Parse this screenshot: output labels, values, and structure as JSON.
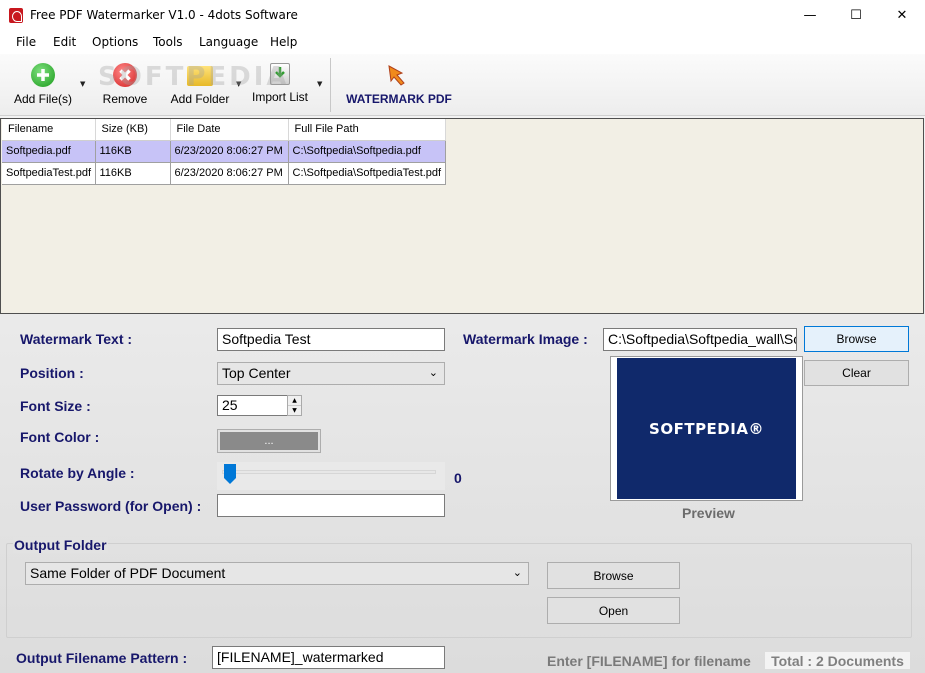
{
  "window": {
    "title": "Free PDF Watermarker V1.0 - 4dots Software",
    "minimize_glyph": "—",
    "maximize_glyph": "☐",
    "close_glyph": "✕"
  },
  "menu": [
    "File",
    "Edit",
    "Options",
    "Tools",
    "Language",
    "Help"
  ],
  "toolbar": {
    "add_files": "Add File(s)",
    "remove": "Remove",
    "add_folder": "Add Folder",
    "import_list": "Import List",
    "watermark_pdf": "WATERMARK PDF",
    "watermark_text_overlay": "SOFTPEDIA",
    "dropdown_glyph": "▼"
  },
  "file_table": {
    "columns": [
      "Filename",
      "Size (KB)",
      "File Date",
      "Full File Path"
    ],
    "rows": [
      [
        "Softpedia.pdf",
        "116KB",
        "6/23/2020 8:06:27 PM",
        "C:\\Softpedia\\Softpedia.pdf"
      ],
      [
        "SoftpediaTest.pdf",
        "116KB",
        "6/23/2020 8:06:27 PM",
        "C:\\Softpedia\\SoftpediaTest.pdf"
      ]
    ]
  },
  "form": {
    "watermark_text_label": "Watermark Text :",
    "watermark_text_value": "Softpedia Test",
    "position_label": "Position :",
    "position_value": "Top Center",
    "font_size_label": "Font Size :",
    "font_size_value": "25",
    "font_color_label": "Font Color :",
    "font_color_button": "...",
    "rotate_label": "Rotate by Angle :",
    "rotate_value": "0",
    "password_label": "User Password (for Open) :",
    "password_value": "",
    "watermark_image_label": "Watermark Image :",
    "watermark_image_value": "C:\\Softpedia\\Softpedia_wall\\So",
    "browse_label": "Browse",
    "clear_label": "Clear",
    "preview_label": "Preview",
    "preview_logo": "SOFTPEDIA®"
  },
  "output": {
    "group_label": "Output Folder",
    "folder_value": "Same Folder of PDF Document",
    "browse_label": "Browse",
    "open_label": "Open",
    "pattern_label": "Output Filename Pattern :",
    "pattern_value": "[FILENAME]_watermarked",
    "hint": "Enter [FILENAME] for filename",
    "total": "Total : 2 Documents"
  },
  "colors": {
    "label_navy": "#17176b",
    "selection": "#c7c3f7",
    "accent": "#0078d7",
    "preview_bg": "#10296b",
    "list_bg": "#f2efe5"
  }
}
